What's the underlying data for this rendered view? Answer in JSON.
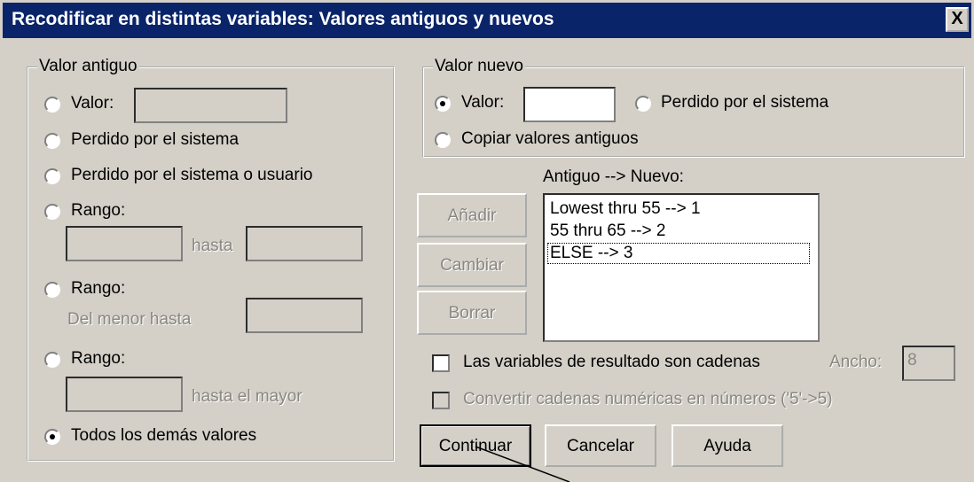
{
  "window": {
    "title": "Recodificar en distintas variables: Valores antiguos y nuevos",
    "close_label": "X"
  },
  "old_value": {
    "legend": "Valor antiguo",
    "valor_label": "Valor:",
    "sysmis_label": "Perdido por el sistema",
    "sysmis_user_label": "Perdido por el sistema o usuario",
    "rango1_label": "Rango:",
    "hasta_label": "hasta",
    "rango2_label": "Rango:",
    "del_menor_label": "Del menor hasta",
    "rango3_label": "Rango:",
    "hasta_mayor_label": "hasta el mayor",
    "todos_label": "Todos los demás valores",
    "selected": "Todos los demás valores"
  },
  "new_value": {
    "legend": "Valor nuevo",
    "valor_label": "Valor:",
    "valor_value": "",
    "sysmis_label": "Perdido por el sistema",
    "copiar_label": "Copiar valores antiguos",
    "selected": "Valor"
  },
  "list": {
    "header": "Antiguo --> Nuevo:",
    "items": [
      "Lowest thru 55 --> 1",
      "55 thru 65 --> 2",
      "ELSE --> 3"
    ]
  },
  "buttons": {
    "anadir": "Añadir",
    "cambiar": "Cambiar",
    "borrar": "Borrar",
    "continuar": "Continuar",
    "cancelar": "Cancelar",
    "ayuda": "Ayuda"
  },
  "options": {
    "string_label": "Las variables de resultado son cadenas",
    "string_checked": false,
    "ancho_label": "Ancho:",
    "ancho_value": "8",
    "convert_label": "Convertir cadenas numéricas en números ('5'->5)",
    "convert_checked": false
  },
  "colors": {
    "titlebar": "#0a246a",
    "face": "#d4d0c8",
    "disabled_text": "#8a8780"
  }
}
